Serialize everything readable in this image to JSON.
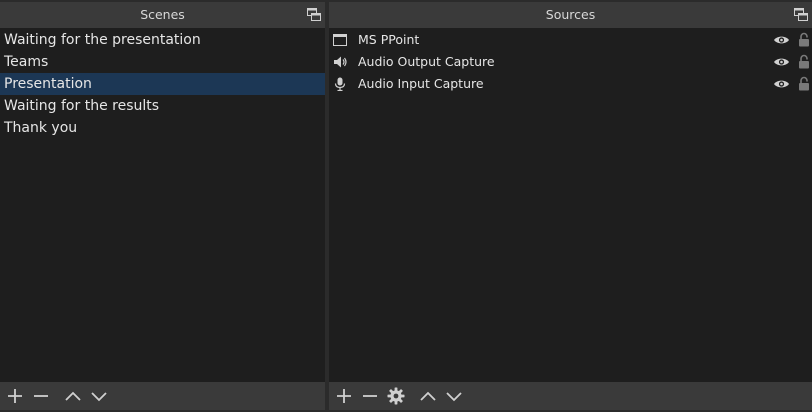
{
  "scenes": {
    "title": "Scenes",
    "items": [
      {
        "label": "Waiting for the presentation",
        "selected": false
      },
      {
        "label": "Teams",
        "selected": false
      },
      {
        "label": "Presentation",
        "selected": true
      },
      {
        "label": "Waiting for the results",
        "selected": false
      },
      {
        "label": "Thank you",
        "selected": false
      }
    ],
    "toolbar": [
      "add-icon",
      "remove-icon",
      "move-up-icon",
      "move-down-icon"
    ]
  },
  "sources": {
    "title": "Sources",
    "items": [
      {
        "label": "MS PPoint",
        "icon": "window-capture-icon",
        "visible": true,
        "locked": false
      },
      {
        "label": "Audio Output Capture",
        "icon": "speaker-icon",
        "visible": true,
        "locked": false
      },
      {
        "label": "Audio Input Capture",
        "icon": "microphone-icon",
        "visible": true,
        "locked": false
      }
    ],
    "toolbar": [
      "add-icon",
      "remove-icon",
      "gear-icon",
      "move-up-icon",
      "move-down-icon"
    ]
  },
  "colors": {
    "panel_bg": "#1e1e1e",
    "title_bg": "#3a3a3a",
    "selected_bg": "#1c3755",
    "text": "#e6e6e6",
    "icon": "#d0d0d0"
  }
}
